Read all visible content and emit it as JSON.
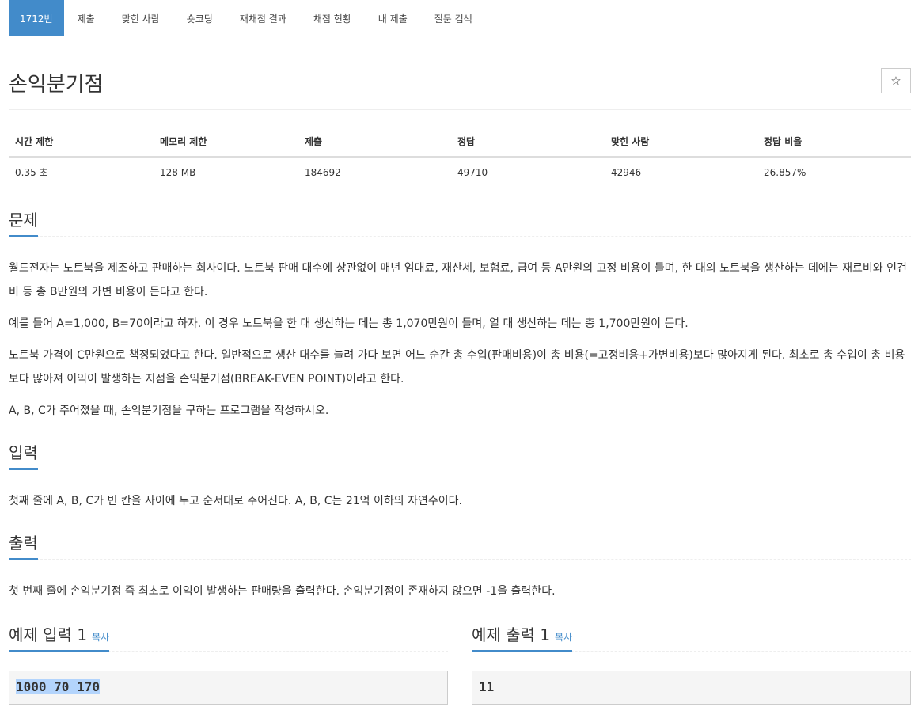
{
  "tabs": [
    {
      "label": "1712번",
      "active": true
    },
    {
      "label": "제출"
    },
    {
      "label": "맞힌 사람"
    },
    {
      "label": "숏코딩"
    },
    {
      "label": "재채점 결과"
    },
    {
      "label": "채점 현황"
    },
    {
      "label": "내 제출"
    },
    {
      "label": "질문 검색"
    }
  ],
  "problem": {
    "title": "손익분기점",
    "star": "☆"
  },
  "stats": {
    "headers": [
      "시간 제한",
      "메모리 제한",
      "제출",
      "정답",
      "맞힌 사람",
      "정답 비율"
    ],
    "values": [
      "0.35 초",
      "128 MB",
      "184692",
      "49710",
      "42946",
      "26.857%"
    ]
  },
  "sections": {
    "problem": {
      "heading": "문제",
      "p1": "월드전자는 노트북을 제조하고 판매하는 회사이다. 노트북 판매 대수에 상관없이 매년 임대료, 재산세, 보험료, 급여 등 A만원의 고정 비용이 들며, 한 대의 노트북을 생산하는 데에는 재료비와 인건비 등 총 B만원의 가변 비용이 든다고 한다.",
      "p2": "예를 들어 A=1,000, B=70이라고 하자. 이 경우 노트북을 한 대 생산하는 데는 총 1,070만원이 들며, 열 대 생산하는 데는 총 1,700만원이 든다.",
      "p3": "노트북 가격이 C만원으로 책정되었다고 한다. 일반적으로 생산 대수를 늘려 가다 보면 어느 순간 총 수입(판매비용)이 총 비용(=고정비용+가변비용)보다 많아지게 된다. 최초로 총 수입이 총 비용보다 많아져 이익이 발생하는 지점을 손익분기점(BREAK-EVEN POINT)이라고 한다.",
      "p4": "A, B, C가 주어졌을 때, 손익분기점을 구하는 프로그램을 작성하시오."
    },
    "input": {
      "heading": "입력",
      "p1": "첫째 줄에 A, B, C가 빈 칸을 사이에 두고 순서대로 주어진다. A, B, C는 21억 이하의 자연수이다."
    },
    "output": {
      "heading": "출력",
      "p1": "첫 번째 줄에 손익분기점 즉 최초로 이익이 발생하는 판매량을 출력한다. 손익분기점이 존재하지 않으면 -1을 출력한다."
    }
  },
  "examples": {
    "input_heading": "예제 입력 1",
    "output_heading": "예제 출력 1",
    "copy_label": "복사",
    "input_value": "1000 70 170",
    "output_value": "11"
  }
}
